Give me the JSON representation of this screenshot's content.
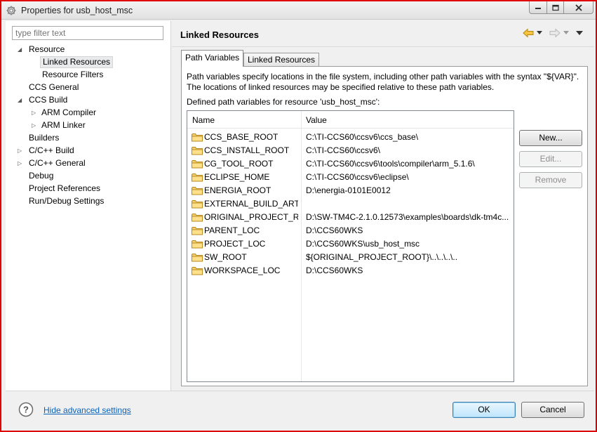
{
  "window": {
    "title": "Properties for usb_host_msc"
  },
  "sidebar": {
    "filter_placeholder": "type filter text",
    "items": [
      {
        "label": "Resource",
        "twisty": "open"
      },
      {
        "label": "Linked Resources",
        "twisty": "none"
      },
      {
        "label": "Resource Filters",
        "twisty": "none"
      },
      {
        "label": "CCS General",
        "twisty": "none"
      },
      {
        "label": "CCS Build",
        "twisty": "open"
      },
      {
        "label": "ARM Compiler",
        "twisty": "closed"
      },
      {
        "label": "ARM Linker",
        "twisty": "closed"
      },
      {
        "label": "Builders",
        "twisty": "none"
      },
      {
        "label": "C/C++ Build",
        "twisty": "closed"
      },
      {
        "label": "C/C++ General",
        "twisty": "closed"
      },
      {
        "label": "Debug",
        "twisty": "none"
      },
      {
        "label": "Project References",
        "twisty": "none"
      },
      {
        "label": "Run/Debug Settings",
        "twisty": "none"
      }
    ],
    "selected": "Linked Resources"
  },
  "main": {
    "title": "Linked Resources",
    "tabs": [
      {
        "label": "Path Variables",
        "active": true
      },
      {
        "label": "Linked Resources",
        "active": false
      }
    ],
    "description": "Path variables specify locations in the file system, including other path variables with the syntax \"${VAR}\". The locations of linked resources may be specified relative to these path variables.",
    "defined_label": "Defined path variables for resource 'usb_host_msc':",
    "table": {
      "columns": [
        "Name",
        "Value"
      ],
      "rows": [
        {
          "name": "CCS_BASE_ROOT",
          "value": "C:\\TI-CCS60\\ccsv6\\ccs_base\\"
        },
        {
          "name": "CCS_INSTALL_ROOT",
          "value": "C:\\TI-CCS60\\ccsv6\\"
        },
        {
          "name": "CG_TOOL_ROOT",
          "value": "C:\\TI-CCS60\\ccsv6\\tools\\compiler\\arm_5.1.6\\"
        },
        {
          "name": "ECLIPSE_HOME",
          "value": "C:\\TI-CCS60\\ccsv6\\eclipse\\"
        },
        {
          "name": "ENERGIA_ROOT",
          "value": "D:\\energia-0101E0012"
        },
        {
          "name": "EXTERNAL_BUILD_ARTI...",
          "value": ""
        },
        {
          "name": "ORIGINAL_PROJECT_R...",
          "value": "D:\\SW-TM4C-2.1.0.12573\\examples\\boards\\dk-tm4c..."
        },
        {
          "name": "PARENT_LOC",
          "value": "D:\\CCS60WKS"
        },
        {
          "name": "PROJECT_LOC",
          "value": "D:\\CCS60WKS\\usb_host_msc"
        },
        {
          "name": "SW_ROOT",
          "value": "${ORIGINAL_PROJECT_ROOT}\\..\\..\\..\\.."
        },
        {
          "name": "WORKSPACE_LOC",
          "value": "D:\\CCS60WKS"
        }
      ]
    },
    "buttons": {
      "new": "New...",
      "edit": "Edit...",
      "remove": "Remove"
    }
  },
  "footer": {
    "advanced_link": "Hide advanced settings",
    "ok": "OK",
    "cancel": "Cancel"
  },
  "colors": {
    "link": "#0b63b6",
    "window_border": "#e00000",
    "folder": "#e8b84a"
  }
}
